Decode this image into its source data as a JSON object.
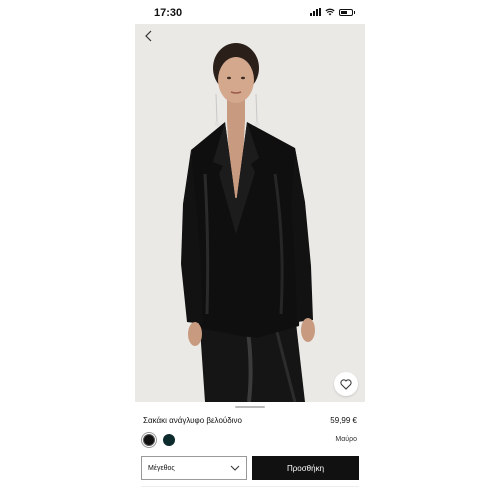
{
  "status_bar": {
    "time": "17:30"
  },
  "product": {
    "name": "Σακάκι ανάγλυφο βελούδινο",
    "price": "59,99 €",
    "selected_color": "Μαύρο",
    "colors": [
      "#111111",
      "#0d2b2d"
    ]
  },
  "actions": {
    "size_label": "Μέγεθος",
    "add_label": "Προσθήκη"
  },
  "icons": {
    "back": "chevron-left-icon",
    "favorite": "heart-icon",
    "dropdown": "chevron-down-icon"
  }
}
